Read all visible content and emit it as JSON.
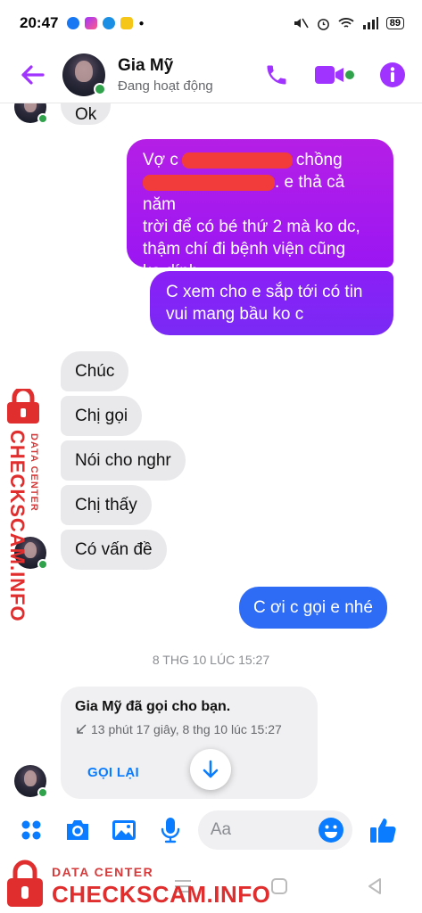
{
  "status_bar": {
    "time": "20:47",
    "battery": "89"
  },
  "header": {
    "contact_name": "Gia Mỹ",
    "contact_status": "Đang hoạt động",
    "accent_color": "#a033ff"
  },
  "messages": {
    "top_incoming": "Ok",
    "out_1_line1_a": "Vợ c",
    "out_1_line1_b": "chồng",
    "out_1_line2": ". e thả cả năm",
    "out_1_line3": "trời để có bé thứ 2 mà ko dc,",
    "out_1_line4": "thậm chí đi bệnh viện cũng",
    "out_1_line5": "ko dính",
    "out_2_line1": "C xem cho e sắp tới có tin",
    "out_2_line2": "vui mang bầu ko c",
    "in_1": "Chúc",
    "in_2": "Chị gọi",
    "in_3": "Nói cho nghr",
    "in_4": "Chị thấy",
    "in_5": "Có vấn đề",
    "out_3": "C ơi c gọi e nhé",
    "timestamp": "8 THG 10 LÚC 15:27"
  },
  "call_card": {
    "title": "Gia Mỹ đã gọi cho bạn.",
    "detail": "13 phút 17 giây, 8 thg 10 lúc 15:27",
    "action": "GỌI LẠI"
  },
  "composer": {
    "placeholder": "Aa"
  },
  "watermark": {
    "small": "DATA CENTER",
    "large": "CHECKSCAM.INFO"
  }
}
